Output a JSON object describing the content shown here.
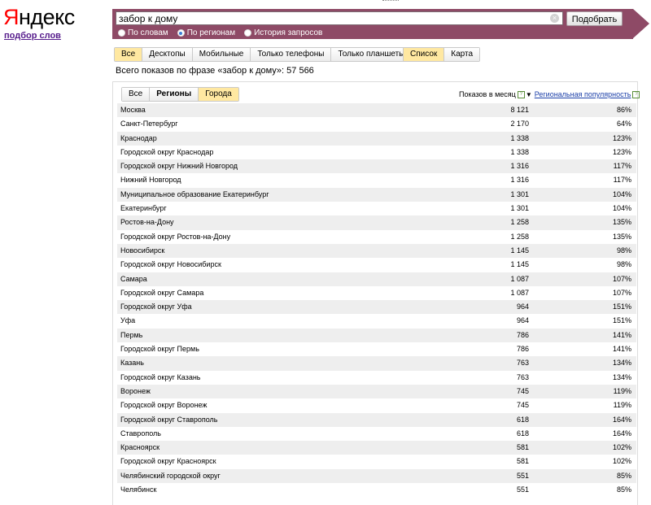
{
  "logo": {
    "ya": "Я",
    "rest": "ндекс"
  },
  "sublink": "подбор слов",
  "search": {
    "query": "забор к дому",
    "button": "Подобрать",
    "radios": [
      {
        "label": "По словам",
        "checked": false
      },
      {
        "label": "По регионам",
        "checked": true
      },
      {
        "label": "История запросов",
        "checked": false
      }
    ]
  },
  "device_tabs": [
    "Все",
    "Десктопы",
    "Мобильные",
    "Только телефоны",
    "Только планшеты"
  ],
  "view_tabs": [
    "Список",
    "Карта"
  ],
  "total_text": "Всего показов по фразе «забор к дому»: 57 566",
  "region_tabs": [
    "Все",
    "Регионы",
    "Города"
  ],
  "columns": {
    "shows": "Показов в месяц",
    "popularity": "Региональная популярность"
  },
  "rows": [
    {
      "name": "Москва",
      "count": "8 121",
      "pct": "86%"
    },
    {
      "name": "Санкт-Петербург",
      "count": "2 170",
      "pct": "64%"
    },
    {
      "name": "Краснодар",
      "count": "1 338",
      "pct": "123%"
    },
    {
      "name": "Городской округ Краснодар",
      "count": "1 338",
      "pct": "123%"
    },
    {
      "name": "Городской округ Нижний Новгород",
      "count": "1 316",
      "pct": "117%"
    },
    {
      "name": "Нижний Новгород",
      "count": "1 316",
      "pct": "117%"
    },
    {
      "name": "Муниципальное образование Екатеринбург",
      "count": "1 301",
      "pct": "104%"
    },
    {
      "name": "Екатеринбург",
      "count": "1 301",
      "pct": "104%"
    },
    {
      "name": "Ростов-на-Дону",
      "count": "1 258",
      "pct": "135%"
    },
    {
      "name": "Городской округ Ростов-на-Дону",
      "count": "1 258",
      "pct": "135%"
    },
    {
      "name": "Новосибирск",
      "count": "1 145",
      "pct": "98%"
    },
    {
      "name": "Городской округ Новосибирск",
      "count": "1 145",
      "pct": "98%"
    },
    {
      "name": "Самара",
      "count": "1 087",
      "pct": "107%"
    },
    {
      "name": "Городской округ Самара",
      "count": "1 087",
      "pct": "107%"
    },
    {
      "name": "Городской округ Уфа",
      "count": "964",
      "pct": "151%"
    },
    {
      "name": "Уфа",
      "count": "964",
      "pct": "151%"
    },
    {
      "name": "Пермь",
      "count": "786",
      "pct": "141%"
    },
    {
      "name": "Городской округ Пермь",
      "count": "786",
      "pct": "141%"
    },
    {
      "name": "Казань",
      "count": "763",
      "pct": "134%"
    },
    {
      "name": "Городской округ Казань",
      "count": "763",
      "pct": "134%"
    },
    {
      "name": "Воронеж",
      "count": "745",
      "pct": "119%"
    },
    {
      "name": "Городской округ Воронеж",
      "count": "745",
      "pct": "119%"
    },
    {
      "name": "Городской округ Ставрополь",
      "count": "618",
      "pct": "164%"
    },
    {
      "name": "Ставрополь",
      "count": "618",
      "pct": "164%"
    },
    {
      "name": "Красноярск",
      "count": "581",
      "pct": "102%"
    },
    {
      "name": "Городской округ Красноярск",
      "count": "581",
      "pct": "102%"
    },
    {
      "name": "Челябинский городской округ",
      "count": "551",
      "pct": "85%"
    },
    {
      "name": "Челябинск",
      "count": "551",
      "pct": "85%"
    }
  ]
}
